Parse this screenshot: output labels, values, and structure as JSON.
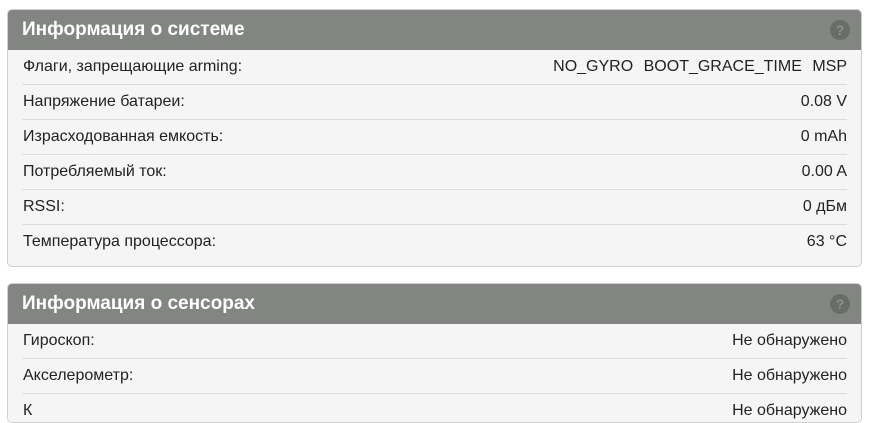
{
  "system": {
    "title": "Информация о системе",
    "help": "?",
    "arming_flags_label": "Флаги, запрещающие arming:",
    "arming_flags": [
      "NO_GYRO",
      "BOOT_GRACE_TIME",
      "MSP"
    ],
    "rows": [
      {
        "label": "Напряжение батареи:",
        "value": "0.08 V"
      },
      {
        "label": "Израсходованная емкость:",
        "value": "0 mAh"
      },
      {
        "label": "Потребляемый ток:",
        "value": "0.00 A"
      },
      {
        "label": "RSSI:",
        "value": "0 дБм"
      },
      {
        "label": "Температура процессора:",
        "value": "63 °C"
      }
    ]
  },
  "sensors": {
    "title": "Информация о сенсорах",
    "help": "?",
    "rows": [
      {
        "label": "Гироскоп:",
        "value": "Не обнаружено"
      },
      {
        "label": "Акселерометр:",
        "value": "Не обнаружено"
      },
      {
        "label": "К",
        "value": "Не обнаружено"
      }
    ]
  }
}
